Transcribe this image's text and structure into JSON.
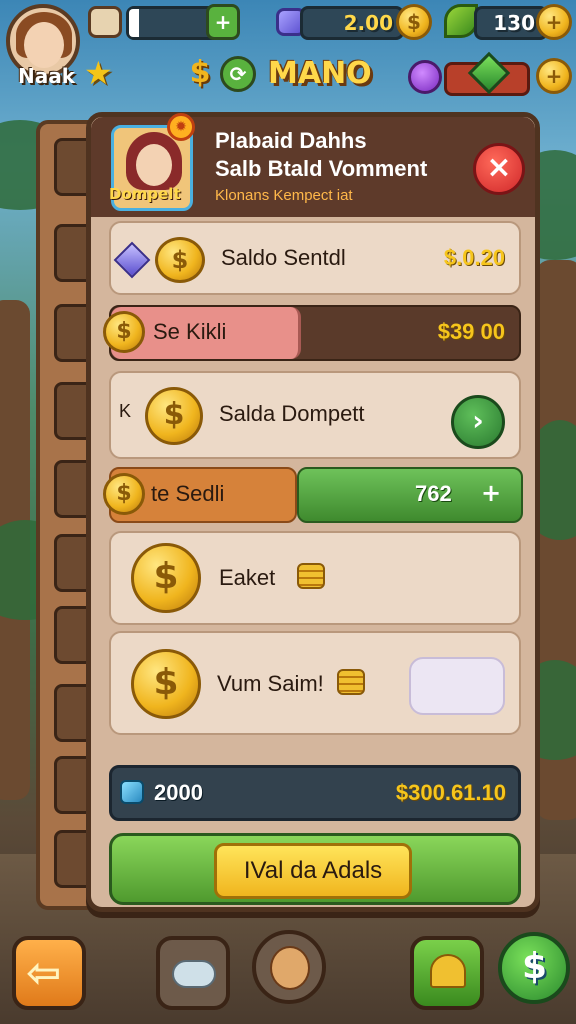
{
  "hud": {
    "player_name": "Naak",
    "energy_value": "",
    "currency_gems": "2.00",
    "currency_leaves": "130",
    "title_logo": "MANO",
    "coin_symbol": "$",
    "plus_symbol": "+"
  },
  "panel": {
    "portrait_label": "Dompelt",
    "title_line1": "Plabaid Dahhs",
    "title_line2": "Salb Btald Vomment",
    "subtitle": "Klonans Kempect iat",
    "close_symbol": "×"
  },
  "rows": {
    "saldo_label": "Saldo Sentdl",
    "saldo_value": "$.0.20",
    "kikli_label": "Se Kikli",
    "kikli_value": "$39 00",
    "dompet_prefix": "K",
    "dompet_label": "Salda Dompett",
    "sendi_label": "te Sedli",
    "sendi_value": "762",
    "eaket_label": "Eaket",
    "vum_label": "Vum Saim!",
    "arrow_symbol": "›"
  },
  "summary": {
    "left_value": "2000",
    "right_value": "$300.61.10"
  },
  "cta": {
    "label": "IVal da Adals"
  },
  "colors": {
    "panel": "#d4b69d",
    "header": "#5e3a2a",
    "gold": "#f6c51c",
    "green": "#4f9a2e",
    "close": "#d0282a"
  }
}
